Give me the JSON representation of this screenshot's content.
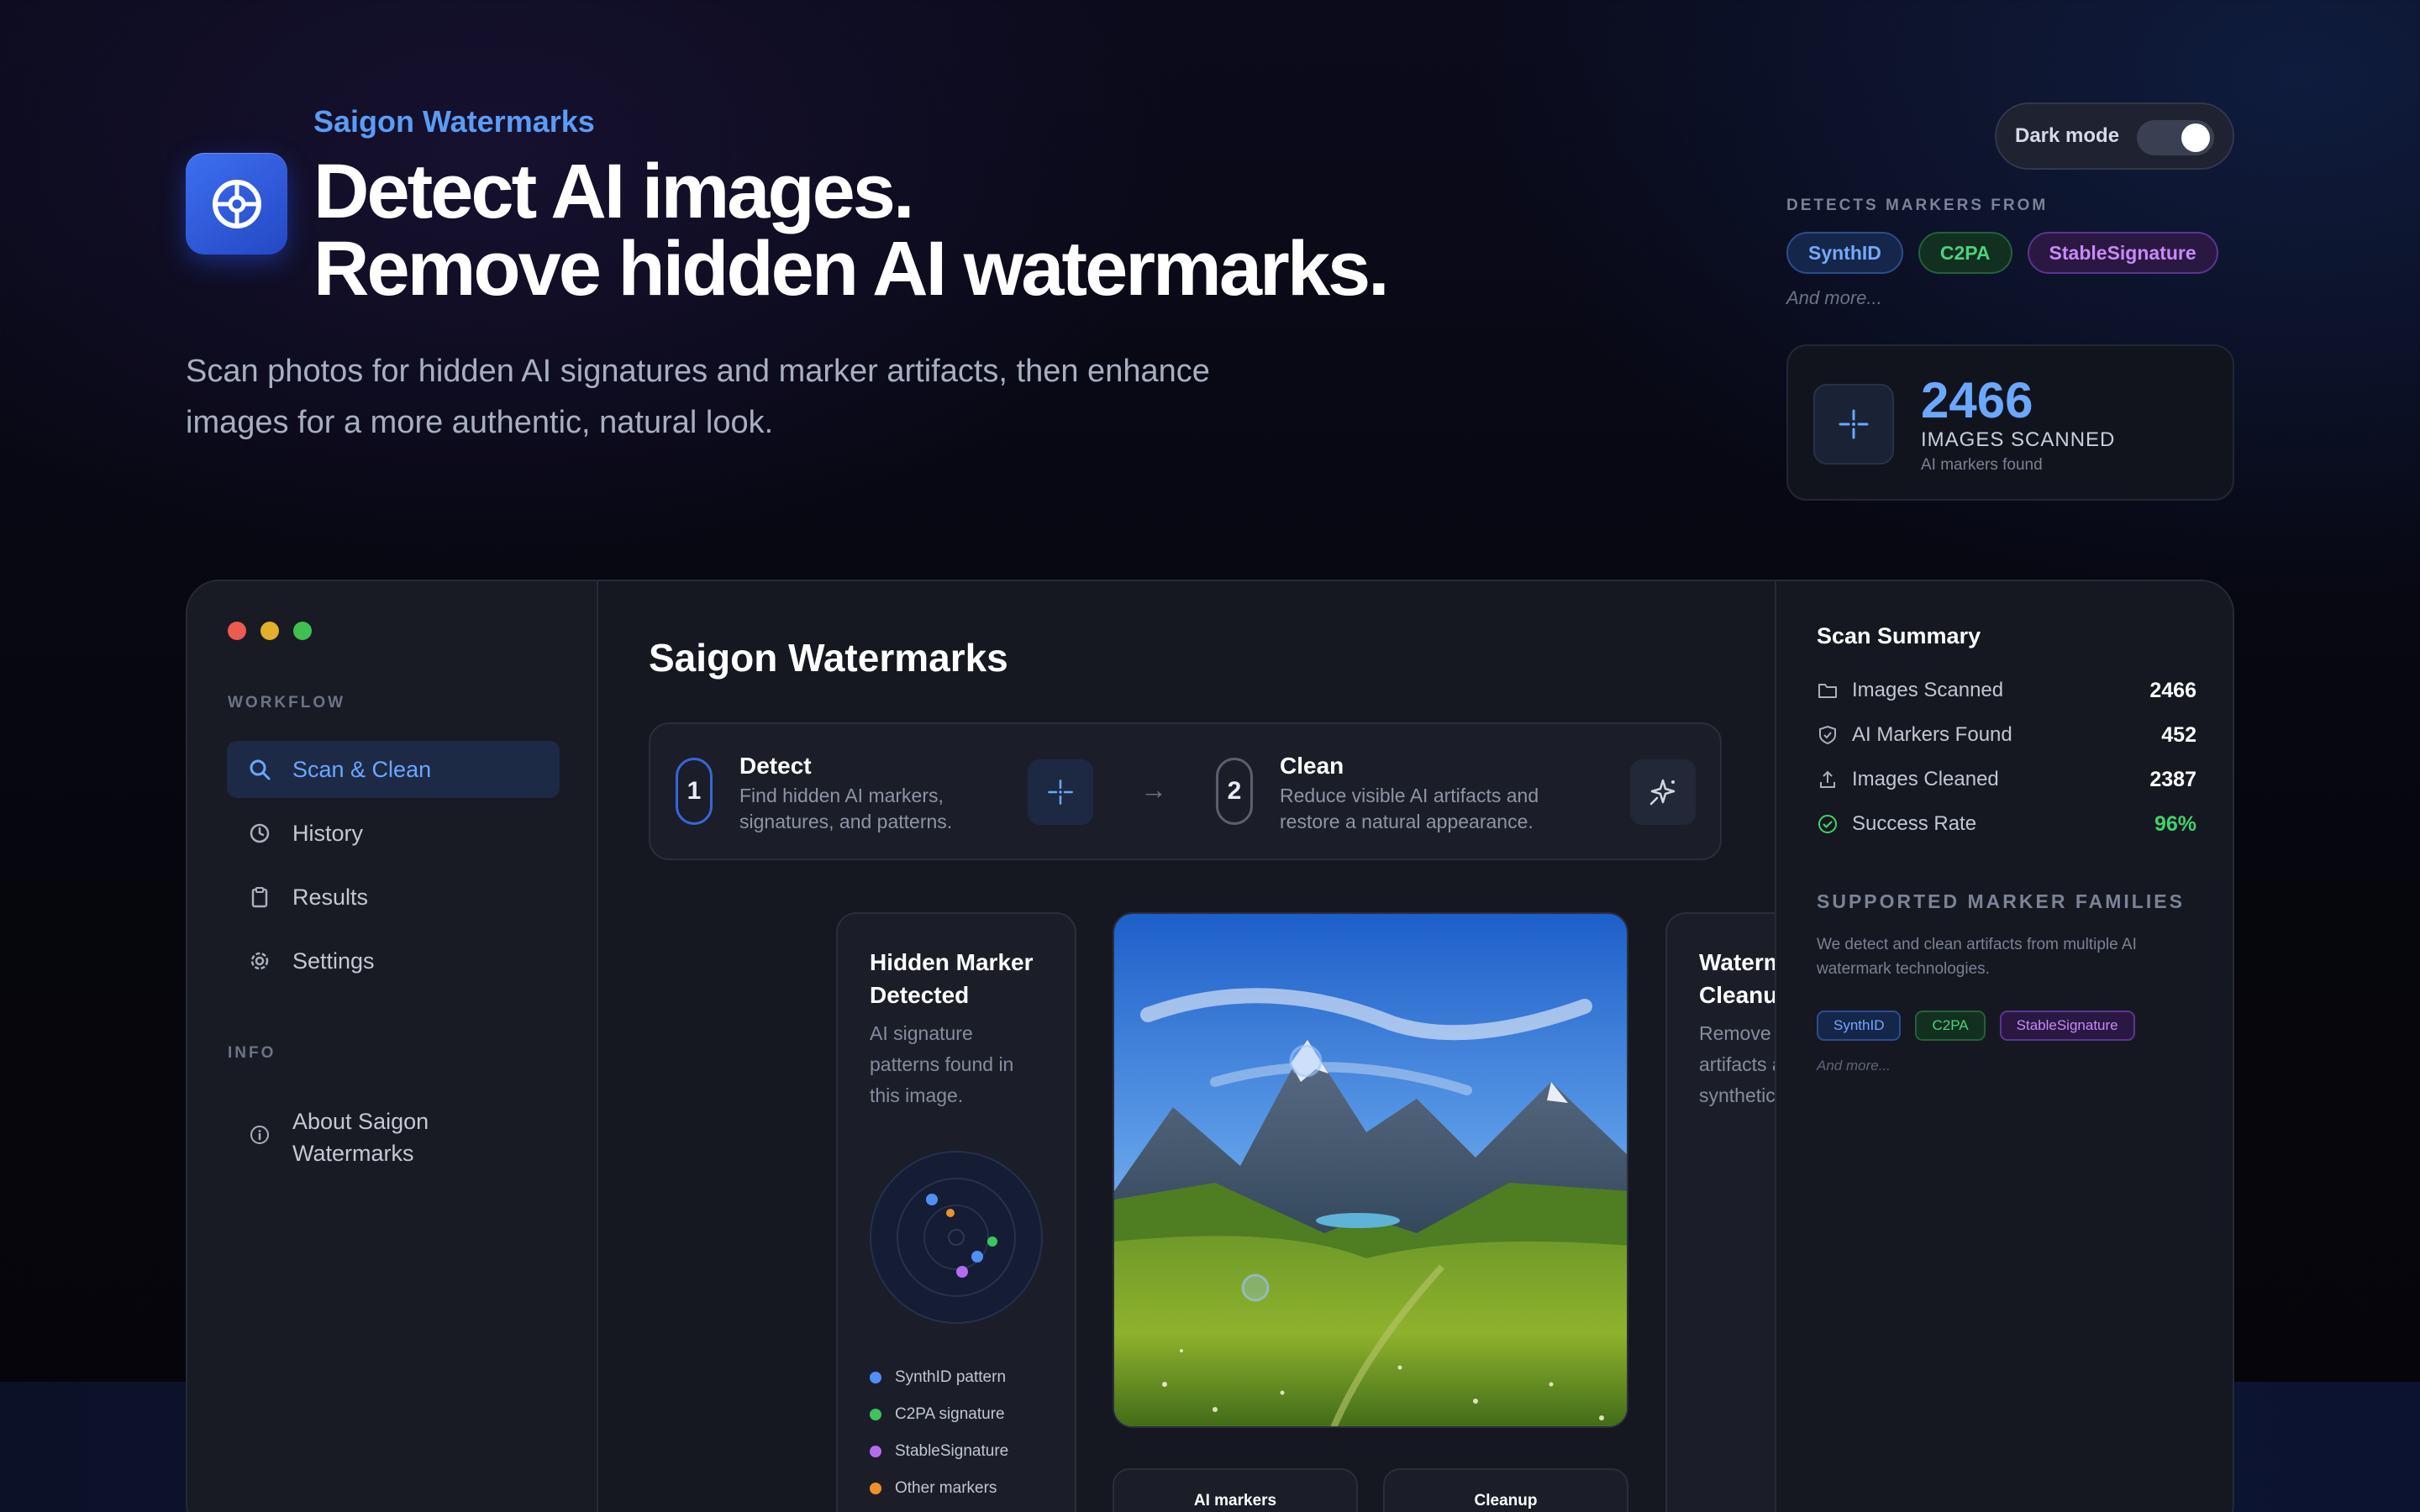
{
  "hero": {
    "brand": "Saigon Watermarks",
    "headline_line1": "Detect AI images.",
    "headline_line2": "Remove hidden AI watermarks.",
    "subheadline": "Scan photos for hidden AI signatures and marker artifacts, then enhance images for a more authentic, natural look."
  },
  "theme_toggle": {
    "label": "Dark mode",
    "on": true
  },
  "markers": {
    "eyebrow": "DETECTS MARKERS FROM",
    "chips": [
      "SynthID",
      "C2PA",
      "StableSignature"
    ],
    "more": "And more..."
  },
  "scan_card": {
    "count": "2466",
    "caption": "IMAGES SCANNED",
    "subcaption": "AI markers found"
  },
  "sidebar": {
    "workflow_label": "WORKFLOW",
    "items": [
      {
        "label": "Scan & Clean",
        "icon": "search-icon",
        "active": true
      },
      {
        "label": "History",
        "icon": "clock-icon"
      },
      {
        "label": "Results",
        "icon": "clipboard-icon"
      },
      {
        "label": "Settings",
        "icon": "gear-icon"
      }
    ],
    "info_label": "INFO",
    "about_line1": "About Saigon",
    "about_line2": "Watermarks"
  },
  "main": {
    "title": "Saigon Watermarks",
    "steps": [
      {
        "number": "1",
        "title": "Detect",
        "desc_line1": "Find hidden AI markers,",
        "desc_line2": "signatures, and patterns."
      },
      {
        "number": "2",
        "title": "Clean",
        "desc_line1": "Reduce visible AI artifacts and",
        "desc_line2": "restore a natural appearance."
      }
    ],
    "detected_card": {
      "title_line1": "Hidden Marker",
      "title_line2": "Detected",
      "desc_line1": "AI signature",
      "desc_line2": "patterns found in",
      "desc_line3": "this image.",
      "legend": [
        {
          "label": "SynthID pattern",
          "color": "#4f8ff7"
        },
        {
          "label": "C2PA signature",
          "color": "#3ec35f"
        },
        {
          "label": "StableSignature",
          "color": "#b36cf0"
        },
        {
          "label": "Other markers",
          "color": "#f0902a"
        }
      ]
    },
    "cleanup_card": {
      "title_line1": "Watermark",
      "title_line2": "Cleanup",
      "desc_line1": "Remove subtle AI",
      "desc_line2": "artifacts and",
      "desc_line3": "synthetic residue."
    },
    "mini_cards": [
      "AI markers",
      "Cleanup"
    ]
  },
  "summary": {
    "title": "Scan Summary",
    "rows": [
      {
        "label": "Images Scanned",
        "value": "2466",
        "icon": "folder-icon"
      },
      {
        "label": "AI Markers Found",
        "value": "452",
        "icon": "shield-icon"
      },
      {
        "label": "Images Cleaned",
        "value": "2387",
        "icon": "upload-icon"
      },
      {
        "label": "Success Rate",
        "value": "96%",
        "icon": "check-circle-icon"
      }
    ],
    "families_title": "SUPPORTED MARKER FAMILIES",
    "families_desc": "We detect and clean artifacts from multiple AI watermark technologies.",
    "family_chips": [
      "SynthID",
      "C2PA",
      "StableSignature"
    ],
    "families_more": "And more..."
  },
  "colors": {
    "accent": "#5b9cf6",
    "success": "#3ed36a",
    "background": "#0b0b1c"
  }
}
